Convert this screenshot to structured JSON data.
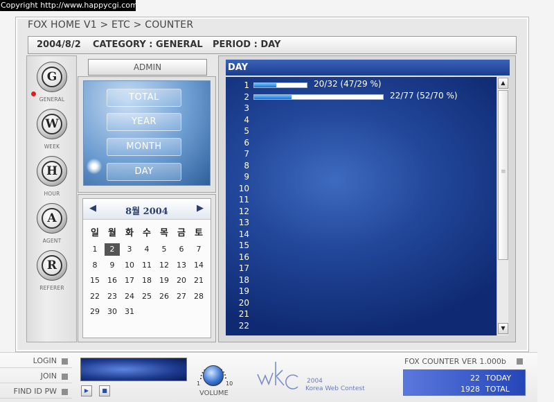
{
  "copyright": "Copyright   http://www.happycgi.com",
  "breadcrumb": "FOX HOME V1 > ETC > COUNTER",
  "info": {
    "date": "2004/8/2",
    "category": "CATEGORY : GENERAL",
    "period": "PERIOD : DAY"
  },
  "nav": [
    {
      "letter": "G",
      "label": "GENERAL"
    },
    {
      "letter": "W",
      "label": "WEEK"
    },
    {
      "letter": "H",
      "label": "HOUR"
    },
    {
      "letter": "A",
      "label": "AGENT"
    },
    {
      "letter": "R",
      "label": "REFERER"
    }
  ],
  "admin_label": "ADMIN",
  "period_buttons": [
    "TOTAL",
    "YEAR",
    "MONTH",
    "DAY"
  ],
  "calendar": {
    "title": "8월 2004",
    "prev": "◀",
    "next": "▶",
    "weekdays": [
      "일",
      "월",
      "화",
      "수",
      "목",
      "금",
      "토"
    ],
    "weeks": [
      [
        "",
        "",
        "",
        "",
        "",
        "",
        ""
      ],
      [
        "1",
        "2",
        "3",
        "4",
        "5",
        "6",
        "7"
      ],
      [
        "8",
        "9",
        "10",
        "11",
        "12",
        "13",
        "14"
      ],
      [
        "15",
        "16",
        "17",
        "18",
        "19",
        "20",
        "21"
      ],
      [
        "22",
        "23",
        "24",
        "25",
        "26",
        "27",
        "28"
      ],
      [
        "29",
        "30",
        "31",
        "",
        "",
        "",
        ""
      ]
    ],
    "selected_day": "2"
  },
  "day_panel": {
    "title": "DAY",
    "rows": [
      "1",
      "2",
      "3",
      "4",
      "5",
      "6",
      "7",
      "8",
      "9",
      "10",
      "11",
      "12",
      "13",
      "14",
      "15",
      "16",
      "17",
      "18",
      "19",
      "20",
      "21",
      "22"
    ],
    "bars": [
      {
        "row": "1",
        "fraction": 0.416,
        "total_fraction": 0.415,
        "label": "20/32 (47/29 %)"
      },
      {
        "row": "2",
        "fraction": 0.286,
        "total_fraction": 1.0,
        "label": "22/77 (52/70 %)"
      }
    ]
  },
  "scroll": {
    "up": "▲",
    "down": "▼",
    "grip": "≡"
  },
  "bottom_links": [
    "LOGIN",
    "JOIN",
    "FIND ID PW"
  ],
  "player": {
    "play": "▶",
    "stop": "■",
    "volume_label": "VOLUME",
    "vol_min": "1",
    "vol_max": "10"
  },
  "contest": {
    "year": "2004",
    "name": "Korea Web Contest"
  },
  "counter": {
    "title": "FOX COUNTER   VER 1.000b",
    "today_value": "22",
    "today_label": "TODAY",
    "total_value": "1928",
    "total_label": "TOTAL"
  },
  "colors": {
    "accent_blue": "#1b3d8f",
    "bar_fill": "#1f70d0",
    "selected_day": "#555555",
    "dot": "#e21b1b"
  }
}
